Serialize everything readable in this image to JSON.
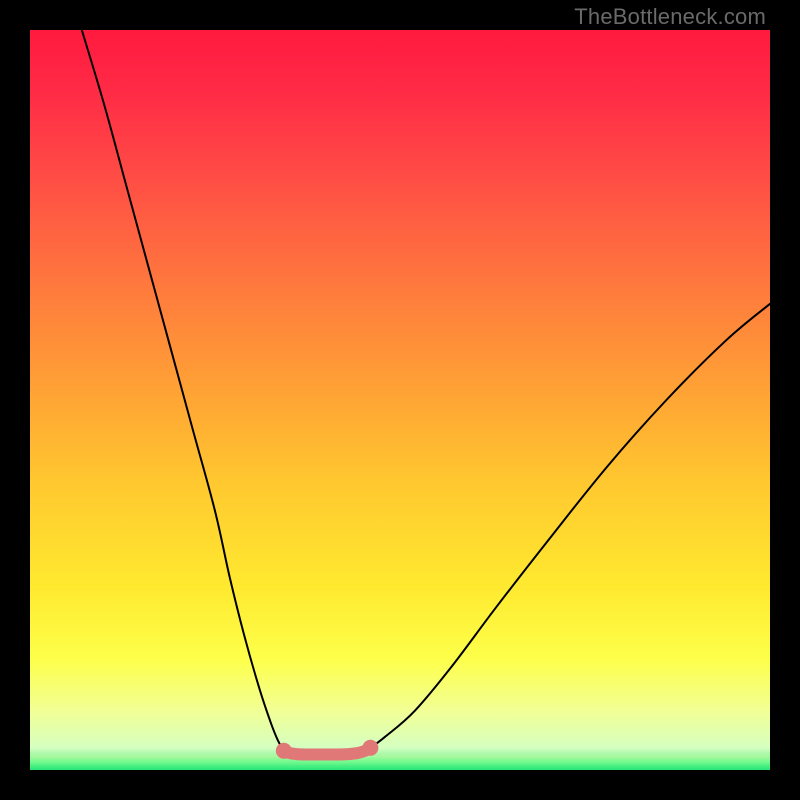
{
  "watermark": {
    "text": "TheBottleneck.com"
  },
  "gradient": {
    "stops": [
      {
        "offset": 0.0,
        "color": "#ff1a3e"
      },
      {
        "offset": 0.08,
        "color": "#ff2a46"
      },
      {
        "offset": 0.2,
        "color": "#ff4d45"
      },
      {
        "offset": 0.35,
        "color": "#ff7a3d"
      },
      {
        "offset": 0.5,
        "color": "#ffa634"
      },
      {
        "offset": 0.62,
        "color": "#ffca2f"
      },
      {
        "offset": 0.75,
        "color": "#ffe92f"
      },
      {
        "offset": 0.85,
        "color": "#fdff4a"
      },
      {
        "offset": 0.92,
        "color": "#f2ff95"
      },
      {
        "offset": 0.97,
        "color": "#d5ffc0"
      },
      {
        "offset": 1.0,
        "color": "#2fe37a"
      }
    ]
  },
  "chart_data": {
    "type": "line",
    "title": "",
    "xlabel": "",
    "ylabel": "",
    "xlim": [
      0,
      100
    ],
    "ylim": [
      0,
      100
    ],
    "series": [
      {
        "name": "left-branch",
        "style": "thin-black",
        "x": [
          7,
          10,
          13,
          16,
          19,
          22,
          25,
          27,
          29,
          31,
          32.5,
          33.5,
          34.3
        ],
        "y": [
          100,
          90,
          79,
          68,
          57,
          46,
          35,
          26,
          18,
          11,
          6.5,
          4,
          2.6
        ]
      },
      {
        "name": "valley-floor",
        "style": "thick-pink",
        "x": [
          34.3,
          35,
          36,
          37.5,
          39.5,
          41.5,
          43,
          44.3,
          45.3,
          46
        ],
        "y": [
          2.6,
          2.3,
          2.15,
          2.1,
          2.1,
          2.1,
          2.15,
          2.3,
          2.6,
          3.0
        ]
      },
      {
        "name": "right-branch",
        "style": "thin-black",
        "x": [
          46,
          48,
          52,
          57,
          63,
          70,
          78,
          86,
          94,
          100
        ],
        "y": [
          3.0,
          4.5,
          8,
          14,
          22,
          31,
          41,
          50,
          58,
          63
        ]
      }
    ],
    "annotations": [
      {
        "text": "TheBottleneck.com",
        "position": "top-right"
      }
    ]
  }
}
